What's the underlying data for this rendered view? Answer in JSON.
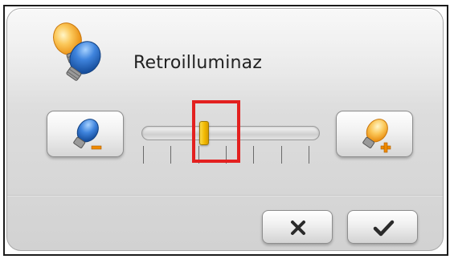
{
  "dialog": {
    "title": "Retroilluminaz"
  },
  "backlight": {
    "level": 0.37,
    "tick_count": 7
  },
  "icons": {
    "header": "lightbulb-pair-icon",
    "decrease": "dim-bulb-minus-icon",
    "increase": "bright-bulb-plus-icon",
    "cancel": "close-x-icon",
    "confirm": "checkmark-icon"
  },
  "colors": {
    "highlight": "#e3201f",
    "thumb": "#f2b900",
    "bulb_off": "#2f6fc9",
    "bulb_on": "#f7b21c"
  }
}
